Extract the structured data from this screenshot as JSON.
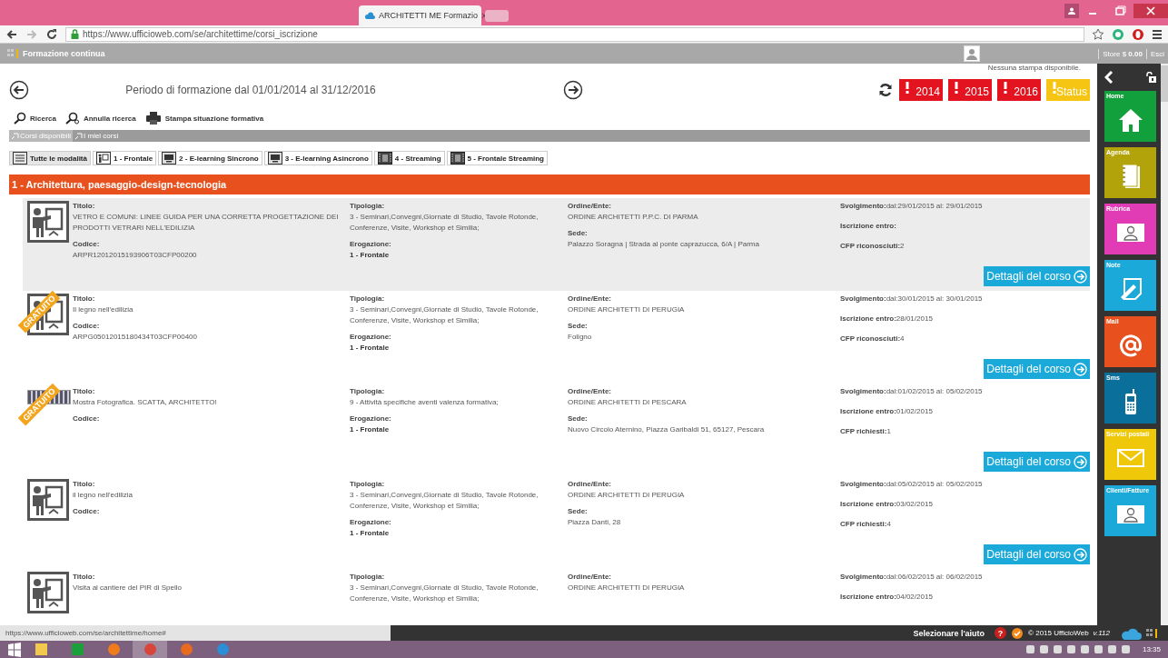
{
  "browser": {
    "tab_title": "ARCHITETTI ME Formazio",
    "tab_close": "×",
    "url": "https://www.ufficioweb.com/se/architettime/corsi_iscrizione"
  },
  "app_header": {
    "title": "Formazione continua",
    "store": "Store $ **0.00**",
    "logout": "Esci"
  },
  "print_notice": "Nessuna stampa disponibile.",
  "period": "Periodo di formazione dal 01/01/2014 al 31/12/2016",
  "year_badges": [
    {
      "label": "2014",
      "color": "#e3141f"
    },
    {
      "label": "2015",
      "color": "#e3141f"
    },
    {
      "label": "2016",
      "color": "#e3141f"
    },
    {
      "label": "Status",
      "color": "#f6c514"
    }
  ],
  "toolbar": [
    {
      "label": "Ricerca",
      "kind": "search"
    },
    {
      "label": "Annulla ricerca",
      "kind": "clear"
    },
    {
      "label": "Stampa situazione formativa",
      "kind": "print"
    }
  ],
  "view_tabs": [
    {
      "label": "Corsi disponibili",
      "selected": true
    },
    {
      "label": "I miei corsi",
      "selected": false
    }
  ],
  "mode_tabs": [
    {
      "label": "Tutte le modalità",
      "kind": "list",
      "selected": true
    },
    {
      "label": "1 - Frontale",
      "kind": "lecture",
      "selected": false
    },
    {
      "label": "2 - E-learning Sincrono",
      "kind": "monitor",
      "selected": false
    },
    {
      "label": "3 - E-learning Asincrono",
      "kind": "monitor",
      "selected": false
    },
    {
      "label": "4 - Streaming",
      "kind": "film",
      "selected": false
    },
    {
      "label": "5 - Frontale Streaming",
      "kind": "film",
      "selected": false
    }
  ],
  "category": "1 - Architettura, paesaggio-design-tecnologia",
  "courses": [
    {
      "highlighted": true,
      "kind": "lecture",
      "columns": [
        {
          "kind": "stacked",
          "fields": [
            {
              "label": "Titolo:",
              "value": "VETRO E COMUNI: LINEE GUIDA PER UNA CORRETTA PROGETTAZIONE DEI PRODOTTI VETRARI NELL'EDILIZIA"
            },
            {
              "label": "Codice:",
              "value": "ARPR12012015193906T03CFP00200"
            }
          ]
        },
        {
          "kind": "stacked",
          "fields": [
            {
              "label": "Tipologia:",
              "value": "3 - Seminari,Convegni,Giornate di Studio, Tavole Rotonde, Conferenze, Visite, Workshop et Similia;"
            },
            {
              "label": "Erogazione:",
              "value": "1 - Frontale",
              "emphasis": true
            }
          ]
        },
        {
          "kind": "stacked",
          "fields": [
            {
              "label": "Ordine/Ente:",
              "value": "ORDINE ARCHITETTI P.P.C. DI PARMA"
            },
            {
              "label": "Sede:",
              "value": "Palazzo Soragna | Strada al ponte caprazucca, 6/A | Parma"
            }
          ]
        },
        {
          "kind": "inline",
          "fields": [
            {
              "label": "Svolgimento:",
              "value": "dal:29/01/2015 al: 29/01/2015"
            },
            {
              "label": "Iscrizione entro:"
            },
            {
              "label": "CFP riconosciuti:",
              "value": "2"
            }
          ]
        }
      ],
      "details_button": "Dettagli del corso"
    },
    {
      "highlighted": false,
      "kind": "lecture",
      "badge": "GRATUITO",
      "columns": [
        {
          "kind": "stacked",
          "fields": [
            {
              "label": "Titolo:",
              "value": "Il legno nell'edilizia"
            },
            {
              "label": "Codice:",
              "value": "ARPG05012015180434T03CFP00400"
            }
          ]
        },
        {
          "kind": "stacked",
          "fields": [
            {
              "label": "Tipologia:",
              "value": "3 - Seminari,Convegni,Giornate di Studio, Tavole Rotonde, Conferenze, Visite, Workshop et Similia;"
            },
            {
              "label": "Erogazione:",
              "value": "1 - Frontale",
              "emphasis": true
            }
          ]
        },
        {
          "kind": "stacked",
          "fields": [
            {
              "label": "Ordine/Ente:",
              "value": "ORDINE ARCHITETTI DI PERUGIA"
            },
            {
              "label": "Sede:",
              "value": "Foligno"
            }
          ]
        },
        {
          "kind": "inline",
          "fields": [
            {
              "label": "Svolgimento:",
              "value": "dal:30/01/2015 al: 30/01/2015"
            },
            {
              "label": "Iscrizione entro:",
              "value": "28/01/2015"
            },
            {
              "label": "CFP riconosciuti:",
              "value": "4"
            }
          ]
        }
      ],
      "details_button": "Dettagli del corso"
    },
    {
      "highlighted": false,
      "kind": "banner",
      "badge": "GRATUITO",
      "columns": [
        {
          "kind": "stacked",
          "fields": [
            {
              "label": "Titolo:",
              "value": "Mostra Fotografica. SCATTA, ARCHITETTO!"
            },
            {
              "label": "Codice:"
            }
          ]
        },
        {
          "kind": "stacked",
          "fields": [
            {
              "label": "Tipologia:",
              "value": "9 - Attività specifiche aventi valenza formativa;"
            },
            {
              "label": "Erogazione:",
              "value": "1 - Frontale",
              "emphasis": true
            }
          ]
        },
        {
          "kind": "stacked",
          "fields": [
            {
              "label": "Ordine/Ente:",
              "value": "ORDINE ARCHITETTI DI PESCARA"
            },
            {
              "label": "Sede:",
              "value": "Nuovo Circolo Aternino, Piazza Garibaldi 51, 65127, Pescara"
            }
          ]
        },
        {
          "kind": "inline",
          "fields": [
            {
              "label": "Svolgimento:",
              "value": "dal:01/02/2015 al: 05/02/2015"
            },
            {
              "label": "Iscrizione entro:",
              "value": "01/02/2015"
            },
            {
              "label": "CFP richiesti:",
              "value": "1"
            }
          ]
        }
      ],
      "details_button": "Dettagli del corso"
    },
    {
      "highlighted": false,
      "kind": "lecture",
      "columns": [
        {
          "kind": "stacked",
          "fields": [
            {
              "label": "Titolo:",
              "value": "il legno nell'edilizia"
            },
            {
              "label": "Codice:"
            }
          ]
        },
        {
          "kind": "stacked",
          "fields": [
            {
              "label": "Tipologia:",
              "value": "3 - Seminari,Convegni,Giornate di Studio, Tavole Rotonde, Conferenze, Visite, Workshop et Similia;"
            },
            {
              "label": "Erogazione:",
              "value": "1 - Frontale",
              "emphasis": true
            }
          ]
        },
        {
          "kind": "stacked",
          "fields": [
            {
              "label": "Ordine/Ente:",
              "value": "ORDINE ARCHITETTI DI PERUGIA"
            },
            {
              "label": "Sede:",
              "value": "Piazza Danti, 28"
            }
          ]
        },
        {
          "kind": "inline",
          "fields": [
            {
              "label": "Svolgimento:",
              "value": "dal:05/02/2015 al: 05/02/2015"
            },
            {
              "label": "Iscrizione entro:",
              "value": "03/02/2015"
            },
            {
              "label": "CFP richiesti:",
              "value": "4"
            }
          ]
        }
      ],
      "details_button": "Dettagli del corso"
    },
    {
      "highlighted": false,
      "kind": "lecture",
      "columns": [
        {
          "kind": "stacked",
          "fields": [
            {
              "label": "Titolo:",
              "value": "Visita al cantiere del PIR di Spello"
            }
          ]
        },
        {
          "kind": "stacked",
          "fields": [
            {
              "label": "Tipologia:",
              "value": "3 - Seminari,Convegni,Giornate di Studio, Tavole Rotonde, Conferenze, Visite, Workshop et Similia;"
            }
          ]
        },
        {
          "kind": "stacked",
          "fields": [
            {
              "label": "Ordine/Ente:",
              "value": "ORDINE ARCHITETTI DI PERUGIA"
            }
          ]
        },
        {
          "kind": "inline",
          "fields": [
            {
              "label": "Svolgimento:",
              "value": "dal:06/02/2015 al: 06/02/2015"
            },
            {
              "label": "Iscrizione entro:",
              "value": "04/02/2015"
            }
          ]
        }
      ]
    }
  ],
  "sidebar": [
    {
      "label": "Home",
      "kind": "home",
      "color": "#12a03c"
    },
    {
      "label": "Agenda",
      "kind": "notebook",
      "color": "#b3a30b"
    },
    {
      "label": "Rubrica",
      "kind": "contact",
      "color": "#e13cb6"
    },
    {
      "label": "Note",
      "kind": "note",
      "color": "#1aa9d9"
    },
    {
      "label": "Mail",
      "kind": "mail",
      "color": "#e8501e"
    },
    {
      "label": "Sms",
      "kind": "phone",
      "color": "#0b6f9b"
    },
    {
      "label": "Servizi postali",
      "kind": "envelope",
      "color": "#f0c80a"
    },
    {
      "label": "Clienti/Fatture",
      "kind": "contact",
      "color": "#1aa9d9"
    }
  ],
  "status_bar": {
    "link_preview": "https://www.ufficioweb.com/se/architettime/home#",
    "help": "Selezionare l'aiuto",
    "help_icon": "?",
    "copyright": "© 2015 UfficioWeb",
    "version": "v.112"
  },
  "taskbar": {
    "time": "13:35"
  }
}
